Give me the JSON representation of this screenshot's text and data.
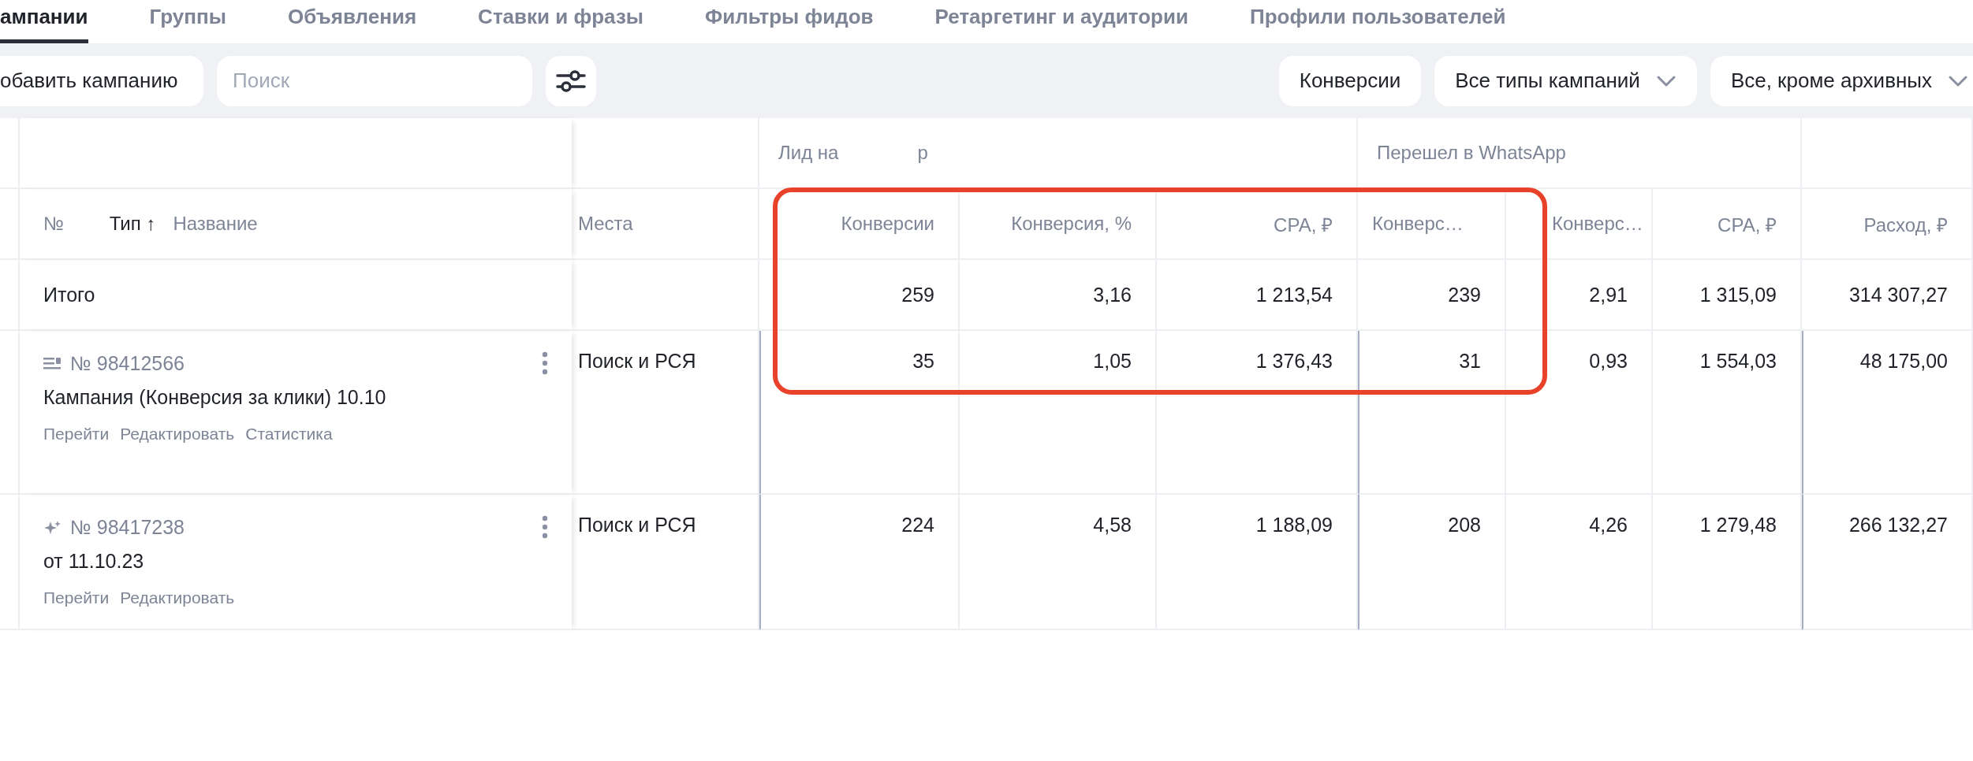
{
  "tabs": [
    {
      "label": "ампании",
      "selected": true
    },
    {
      "label": "Группы",
      "selected": false
    },
    {
      "label": "Объявления",
      "selected": false
    },
    {
      "label": "Ставки и фразы",
      "selected": false
    },
    {
      "label": "Фильтры фидов",
      "selected": false
    },
    {
      "label": "Ретаргетинг и аудитории",
      "selected": false
    },
    {
      "label": "Профили пользователей",
      "selected": false
    }
  ],
  "toolbar": {
    "add_button": "обавить кампанию",
    "search": {
      "placeholder": "Поиск"
    },
    "right_buttons": [
      {
        "label": "Конверсии",
        "dropdown": false
      },
      {
        "label": "Все типы кампаний",
        "dropdown": true
      },
      {
        "label": "Все, кроме архивных",
        "dropdown": true
      }
    ]
  },
  "table": {
    "groups": [
      {
        "label": "Лид на",
        "label_end": "р"
      },
      {
        "label": "Перешел в WhatsApp"
      }
    ],
    "name_columns": [
      {
        "label": "№",
        "sorted": false
      },
      {
        "label": "Тип",
        "sorted": true,
        "sort_mark": "↑"
      },
      {
        "label": "Название",
        "sorted": false
      }
    ],
    "places_column": "Места",
    "columns": [
      {
        "label": "Конверсии"
      },
      {
        "label": "Конверсия, %"
      },
      {
        "label": "CPA, ₽"
      },
      {
        "label": "Конверс…"
      },
      {
        "label": "Конверс…"
      },
      {
        "label": "CPA, ₽"
      },
      {
        "label": "Расход, ₽"
      }
    ],
    "total": {
      "label": "Итого",
      "values": [
        "259",
        "3,16",
        "1 213,54",
        "239",
        "2,91",
        "1 315,09",
        "314 307,27"
      ]
    },
    "rows": [
      {
        "kind": "text",
        "number": "№ 98412566",
        "name": "Кампания (Конверсия за клики) 10.10",
        "places": "Поиск и РСЯ",
        "actions": [
          "Перейти",
          "Редактировать",
          "Статистика"
        ],
        "values": [
          "35",
          "1,05",
          "1 376,43",
          "31",
          "0,93",
          "1 554,03",
          "48 175,00"
        ]
      },
      {
        "kind": "smart",
        "number": "№ 98417238",
        "name": "от 11.10.23",
        "places": "Поиск и РСЯ",
        "actions": [
          "Перейти",
          "Редактировать"
        ],
        "values": [
          "224",
          "4,58",
          "1 188,09",
          "208",
          "4,26",
          "1 279,48",
          "266 132,27"
        ]
      }
    ]
  }
}
